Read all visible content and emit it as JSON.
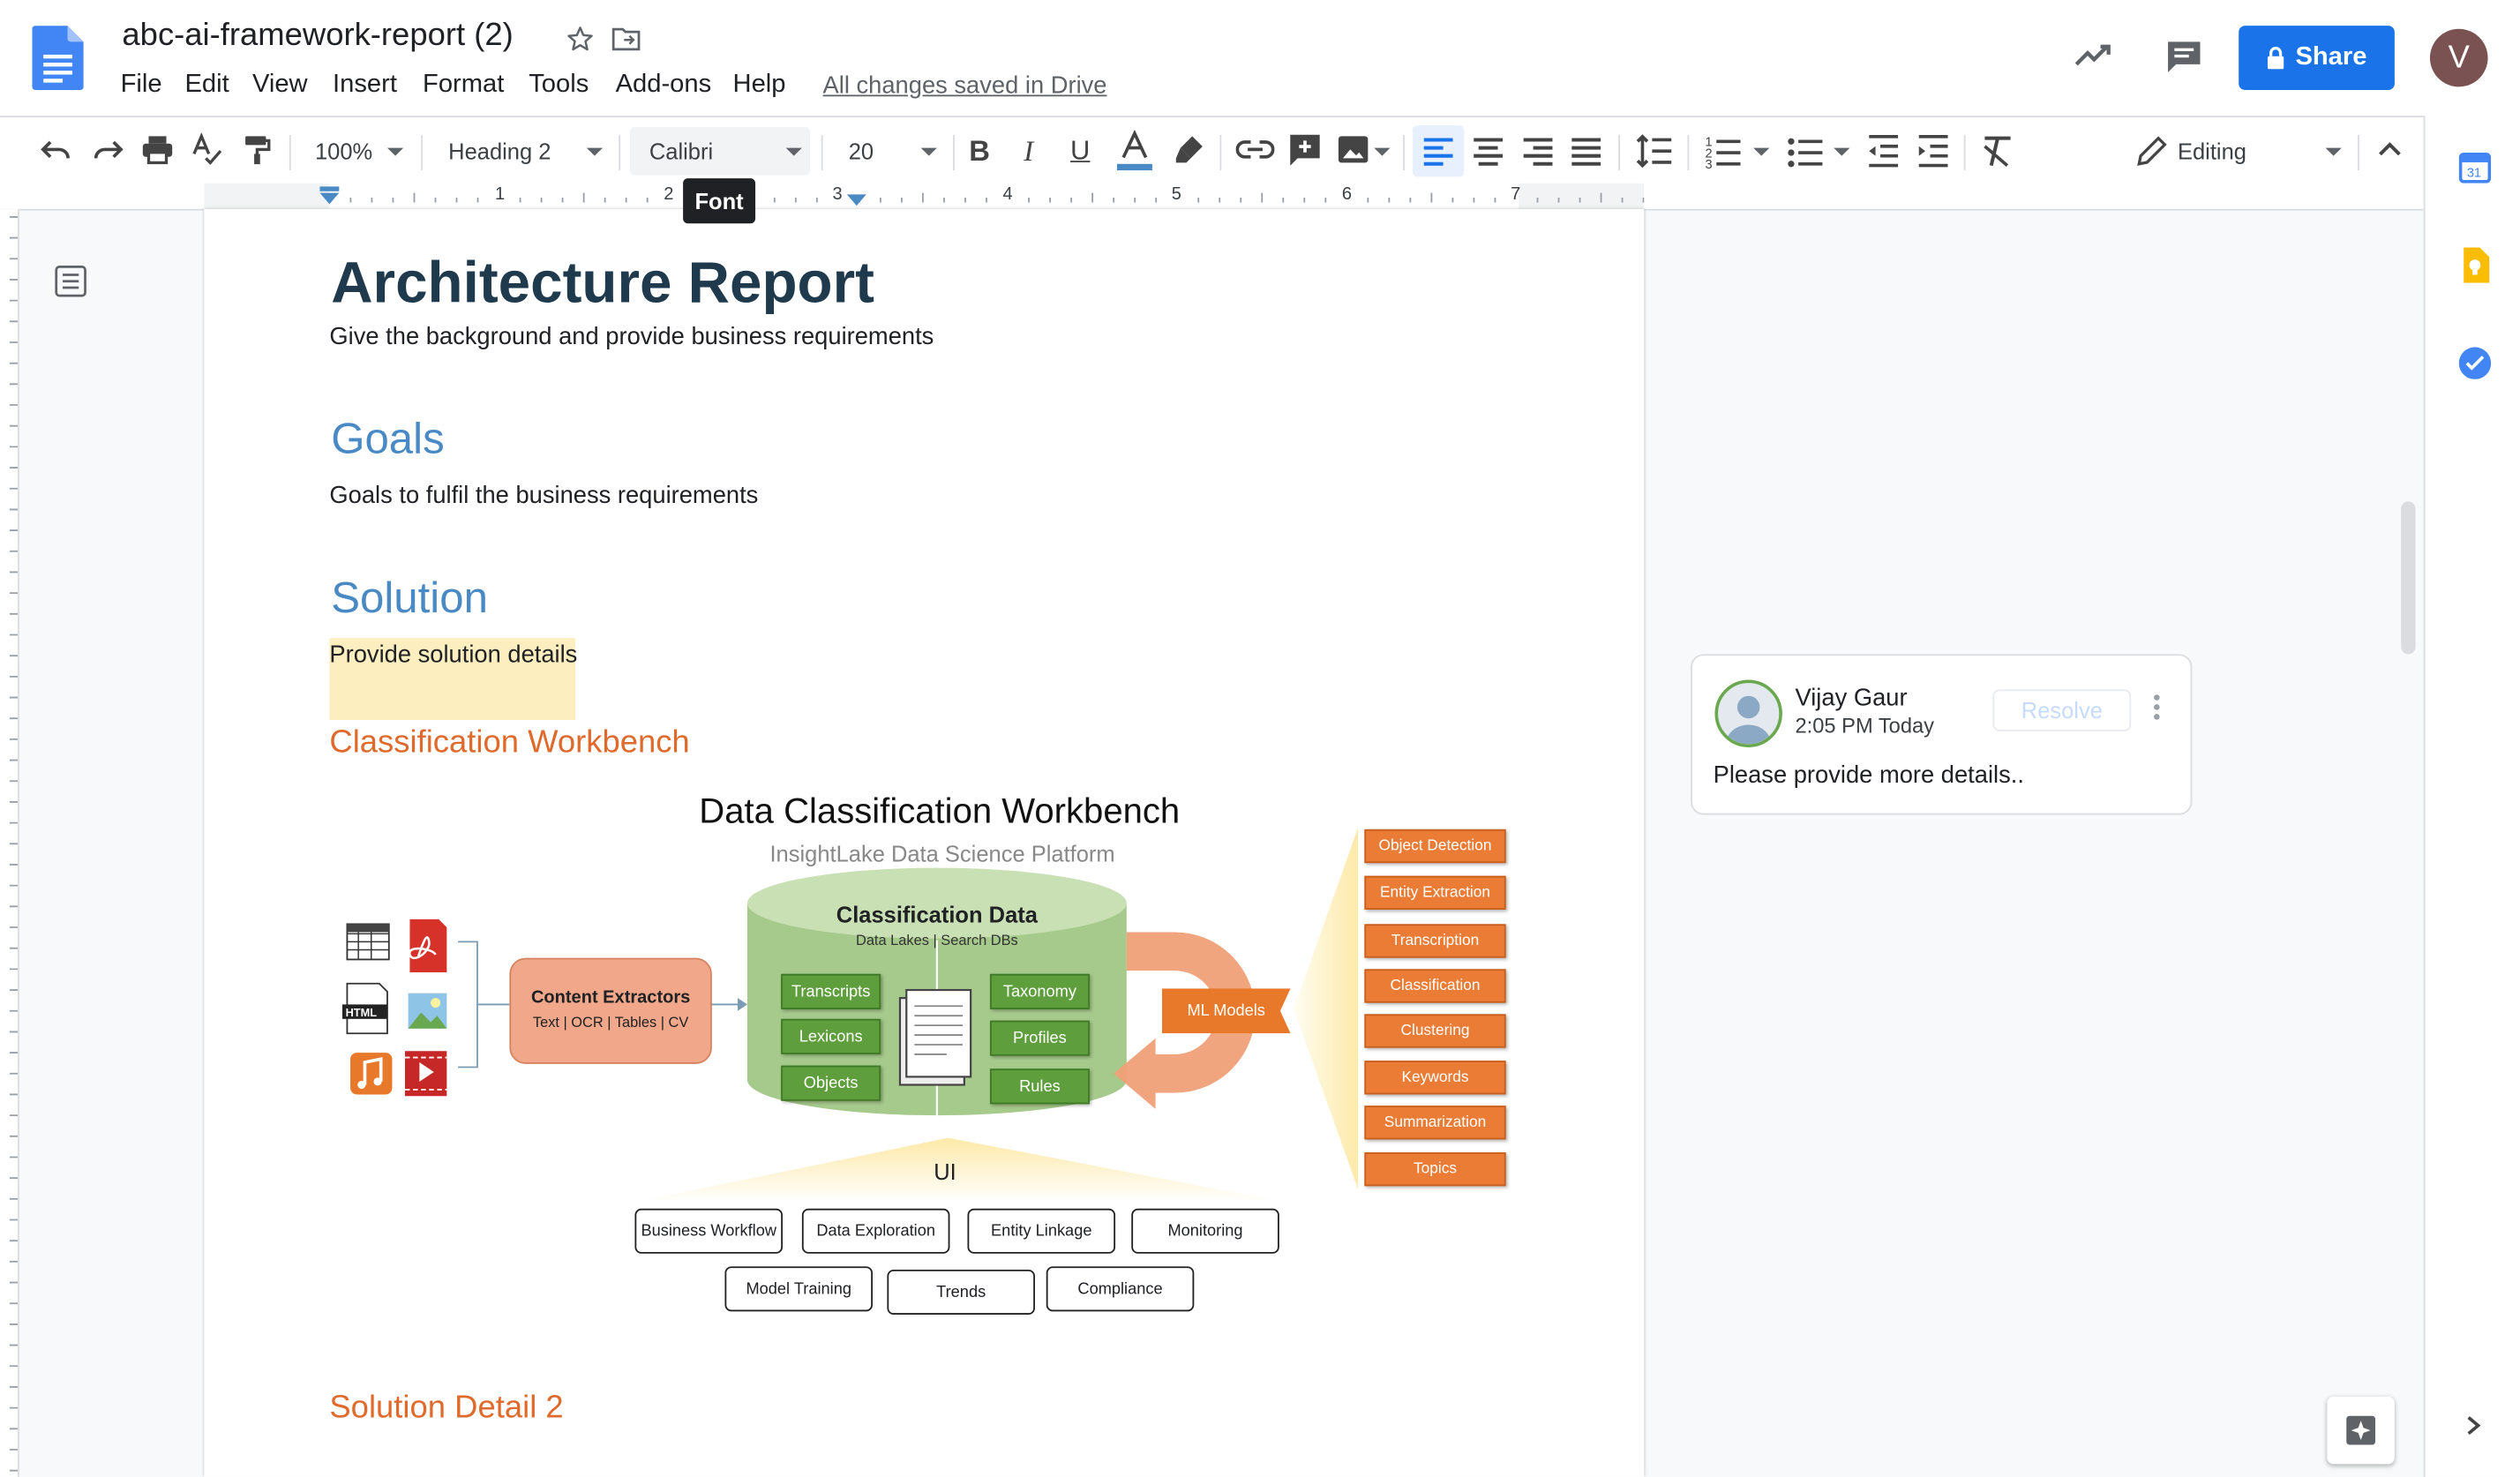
{
  "document": {
    "title": "abc-ai-framework-report (2)",
    "save_status": "All changes saved in Drive"
  },
  "menu": [
    "File",
    "Edit",
    "View",
    "Insert",
    "Format",
    "Tools",
    "Add-ons",
    "Help"
  ],
  "header": {
    "share_label": "Share",
    "avatar_initial": "V"
  },
  "toolbar": {
    "zoom": "100%",
    "style": "Heading 2",
    "font": "Calibri",
    "font_size": "20",
    "mode": "Editing",
    "tooltip": "Font"
  },
  "ruler": {
    "marks": [
      "1",
      "2",
      "3",
      "4",
      "5",
      "6",
      "7"
    ]
  },
  "content": {
    "title": "Architecture Report",
    "intro": "Give the background and provide business requirements",
    "goals_heading": "Goals",
    "goals_text": "Goals to fulfil the business requirements",
    "solution_heading": "Solution",
    "solution_text": "Provide solution details",
    "workbench_heading": "Classification Workbench",
    "detail2_heading": "Solution Detail 2"
  },
  "diagram": {
    "title": "Data Classification Workbench",
    "subtitle": "InsightLake Data Science Platform",
    "extractors_title": "Content Extractors",
    "extractors_sub": "Text | OCR | Tables | CV",
    "data_title": "Classification Data",
    "data_sub": "Data Lakes | Search DBs",
    "left_boxes": [
      "Transcripts",
      "Lexicons",
      "Objects"
    ],
    "right_boxes": [
      "Taxonomy",
      "Profiles",
      "Rules"
    ],
    "ml_label": "ML Models",
    "ml_items": [
      "Object Detection",
      "Entity Extraction",
      "Transcription",
      "Classification",
      "Clustering",
      "Keywords",
      "Summarization",
      "Topics"
    ],
    "ui_label": "UI",
    "ui_row1": [
      "Business Workflow",
      "Data Exploration",
      "Entity Linkage",
      "Monitoring"
    ],
    "ui_row2": [
      "Model Training",
      "Trends",
      "Compliance"
    ]
  },
  "comment": {
    "author": "Vijay Gaur",
    "time": "2:05 PM Today",
    "resolve_label": "Resolve",
    "text": "Please provide more details.."
  },
  "colors": {
    "accent": "#1a73e8",
    "heading_blue": "#4a8ac4",
    "heading_orange": "#e06a2c",
    "title_dark": "#1e3a4c",
    "highlight": "#fdeec0"
  }
}
